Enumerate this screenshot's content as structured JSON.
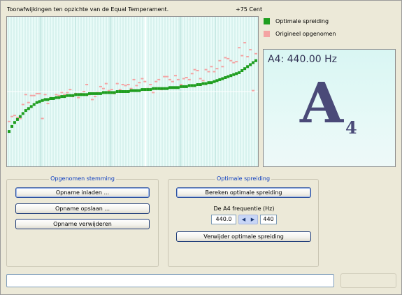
{
  "chart_header": {
    "title": "Toonafwijkingen ten opzichte van de Equal Temperament.",
    "cents": "+75 Cent"
  },
  "legend": {
    "optimal": "Optimale spreiding",
    "original": "Origineel opgenomen"
  },
  "colors": {
    "optimal": "#1f9e1f",
    "original": "#f4a3a3",
    "accent": "#0a3cc0"
  },
  "note_display": {
    "frequency": "A4: 440.00 Hz",
    "letter": "A",
    "octave": "4"
  },
  "recorded_group": {
    "title": "Opgenomen stemming",
    "load_label": "Opname inladen ...",
    "save_label": "Opname opslaan ...",
    "delete_label": "Opname verwijderen"
  },
  "optimal_group": {
    "title": "Optimale spreiding",
    "calc_label": "Bereken optimale spreiding",
    "freq_label": "De A4 frequentie (Hz)",
    "freq_value": "440.0",
    "freq_target": "440",
    "spin_left": "◀",
    "spin_right": "▶",
    "remove_label": "Verwijder optimale spreiding"
  },
  "status_input": {
    "value": ""
  },
  "chart_data": {
    "type": "scatter",
    "title": "Toonafwijkingen ten opzichte van de Equal Temperament.",
    "ylim": [
      -75,
      75
    ],
    "y_max_label": "+75 Cent",
    "grid": true,
    "legend_position": "right",
    "series": [
      {
        "name": "Optimale spreiding",
        "values": [
          -40,
          -35,
          -31,
          -28,
          -25,
          -22,
          -19,
          -17,
          -15,
          -13,
          -11,
          -10,
          -9,
          -8,
          -8,
          -7,
          -7,
          -6,
          -6,
          -5,
          -5,
          -4,
          -4,
          -4,
          -3,
          -3,
          -3,
          -3,
          -3,
          -2,
          -2,
          -2,
          -2,
          -2,
          -1,
          -1,
          -1,
          -1,
          -1,
          0,
          0,
          0,
          0,
          0,
          1,
          1,
          1,
          1,
          2,
          2,
          2,
          2,
          3,
          3,
          3,
          3,
          3,
          3,
          4,
          4,
          4,
          4,
          5,
          5,
          5,
          6,
          6,
          6,
          7,
          7,
          8,
          8,
          9,
          9,
          10,
          11,
          12,
          13,
          14,
          15,
          16,
          17,
          18,
          19,
          21,
          23,
          25,
          27,
          29,
          31
        ]
      },
      {
        "name": "Origineel opgenomen",
        "values": [
          -30,
          -25,
          -24,
          -26,
          -27,
          -13,
          -3,
          -11,
          -4,
          -4,
          -2,
          -2,
          -27,
          -3,
          -12,
          -6,
          -7,
          -3,
          -4,
          -1,
          -3,
          -1,
          2,
          -5,
          -2,
          -6,
          -2,
          0,
          7,
          -3,
          -8,
          -5,
          -1,
          5,
          3,
          8,
          1,
          2,
          -2,
          8,
          2,
          7,
          6,
          7,
          3,
          12,
          6,
          9,
          13,
          10,
          3,
          7,
          -1,
          10,
          12,
          2,
          15,
          15,
          12,
          10,
          16,
          12,
          7,
          13,
          14,
          12,
          18,
          22,
          21,
          13,
          11,
          22,
          20,
          25,
          20,
          23,
          31,
          25,
          34,
          33,
          31,
          29,
          30,
          44,
          36,
          49,
          35,
          42,
          1,
          38
        ]
      }
    ]
  }
}
